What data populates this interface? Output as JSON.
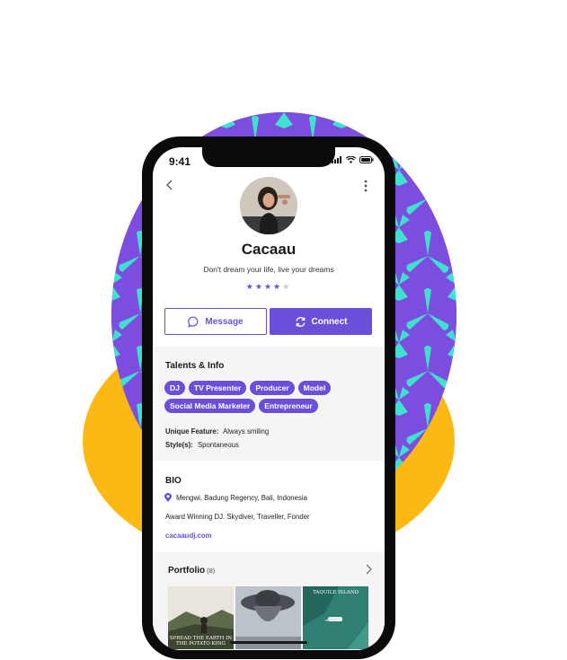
{
  "status_bar": {
    "time": "9:41"
  },
  "profile": {
    "name": "Cacaau",
    "tagline": "Don't dream your life, live your dreams",
    "rating": 4,
    "rating_max": 5
  },
  "actions": {
    "message_label": "Message",
    "connect_label": "Connect"
  },
  "talents": {
    "title": "Talents & Info",
    "chips": [
      "DJ",
      "TV Presenter",
      "Producer",
      "Model",
      "Social Media Marketer",
      "Entrepreneur"
    ],
    "unique_feature_label": "Unique Feature:",
    "unique_feature_value": "Always smiling",
    "styles_label": "Style(s):",
    "styles_value": "Spontaneous"
  },
  "bio": {
    "title": "BIO",
    "location": "Mengwi, Badung Regency, Bali, Indonesia",
    "description": "Award Winning DJ. Skydiver, Traveller, Fonder",
    "link": "cacaaudj.com"
  },
  "portfolio": {
    "title": "Portfolio",
    "count": "(8)",
    "items": [
      {
        "caption": "SPREAD THE EARTH IN THE POTATO KING"
      },
      {
        "caption": ""
      },
      {
        "caption": "TAQUILE ISLAND"
      }
    ]
  },
  "colors": {
    "accent": "#6B4FD8",
    "blob_yellow": "#FDB913",
    "blob_purple": "#7C4DDF",
    "pattern_teal": "#3FE0D0",
    "section_bg": "#f5f5f6"
  }
}
